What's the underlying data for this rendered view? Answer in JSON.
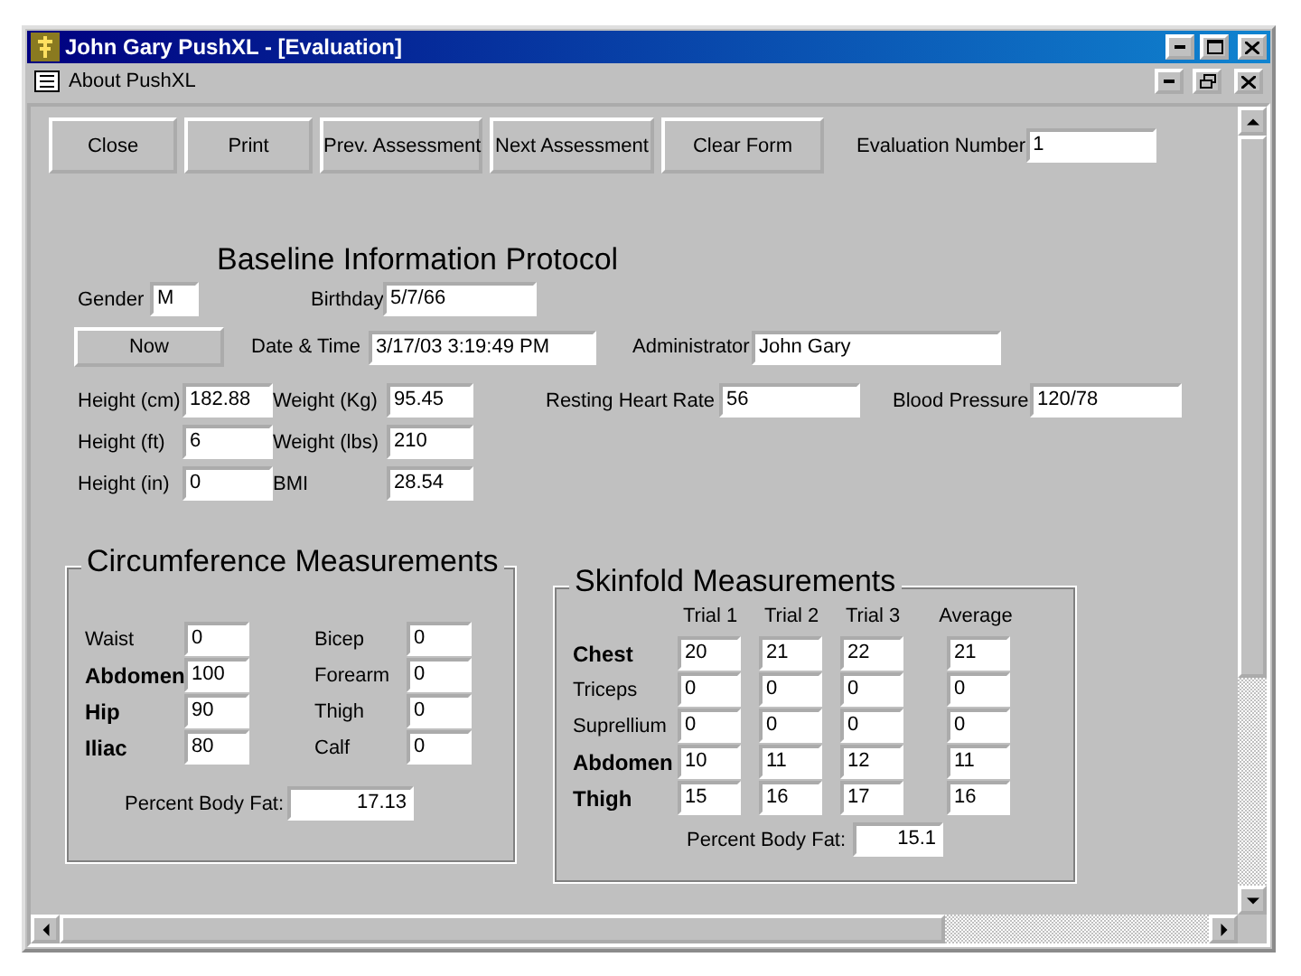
{
  "window": {
    "title": "John Gary PushXL - [Evaluation]"
  },
  "menu": {
    "items": [
      {
        "label": "About PushXL"
      }
    ]
  },
  "toolbar": {
    "buttons": [
      {
        "label": "Close"
      },
      {
        "label": "Print"
      },
      {
        "label": "Prev. Assessment"
      },
      {
        "label": "Next Assessment"
      },
      {
        "label": "Clear Form"
      }
    ],
    "evaluation_number": {
      "label": "Evaluation Number",
      "value": "1"
    }
  },
  "baseline": {
    "title": "Baseline Information Protocol",
    "gender": {
      "label": "Gender",
      "value": "M"
    },
    "birthday": {
      "label": "Birthday",
      "value": "5/7/66"
    },
    "now_button": {
      "label": "Now"
    },
    "date_time": {
      "label": "Date & Time",
      "value": "3/17/03 3:19:49 PM"
    },
    "administrator": {
      "label": "Administrator",
      "value": "John Gary"
    },
    "rows": [
      [
        {
          "label": "Height (cm)",
          "value": "182.88"
        },
        {
          "label": "Weight (Kg)",
          "value": "95.45"
        },
        {
          "label": "Resting Heart Rate",
          "value": "56"
        },
        {
          "label": "Blood Pressure",
          "value": "120/78"
        }
      ],
      [
        {
          "label": "Height (ft)",
          "value": "6"
        },
        {
          "label": "Weight (lbs)",
          "value": "210"
        }
      ],
      [
        {
          "label": "Height (in)",
          "value": "0"
        },
        {
          "label": "BMI",
          "value": "28.54"
        }
      ]
    ]
  },
  "circumference": {
    "title": "Circumference Measurements",
    "left": [
      {
        "label": "Waist",
        "value": "0",
        "bold": false
      },
      {
        "label": "Abdomen",
        "value": "100",
        "bold": true
      },
      {
        "label": "Hip",
        "value": "90",
        "bold": true
      },
      {
        "label": "Iliac",
        "value": "80",
        "bold": true
      }
    ],
    "right": [
      {
        "label": "Bicep",
        "value": "0",
        "bold": false
      },
      {
        "label": "Forearm",
        "value": "0",
        "bold": false
      },
      {
        "label": "Thigh",
        "value": "0",
        "bold": false
      },
      {
        "label": "Calf",
        "value": "0",
        "bold": false
      }
    ],
    "body_fat": {
      "label": "Percent Body Fat:",
      "value": "17.13"
    }
  },
  "skinfold": {
    "title": "Skinfold Measurements",
    "columns": [
      "Trial 1",
      "Trial 2",
      "Trial 3",
      "Average"
    ],
    "rows": [
      {
        "label": "Chest",
        "bold": true,
        "values": [
          "20",
          "21",
          "22",
          "21"
        ]
      },
      {
        "label": "Triceps",
        "bold": false,
        "values": [
          "0",
          "0",
          "0",
          "0"
        ]
      },
      {
        "label": "Suprellium",
        "bold": false,
        "values": [
          "0",
          "0",
          "0",
          "0"
        ]
      },
      {
        "label": "Abdomen",
        "bold": true,
        "values": [
          "10",
          "11",
          "12",
          "11"
        ]
      },
      {
        "label": "Thigh",
        "bold": true,
        "values": [
          "15",
          "16",
          "17",
          "16"
        ]
      }
    ],
    "body_fat": {
      "label": "Percent Body Fat:",
      "value": "15.1"
    }
  }
}
